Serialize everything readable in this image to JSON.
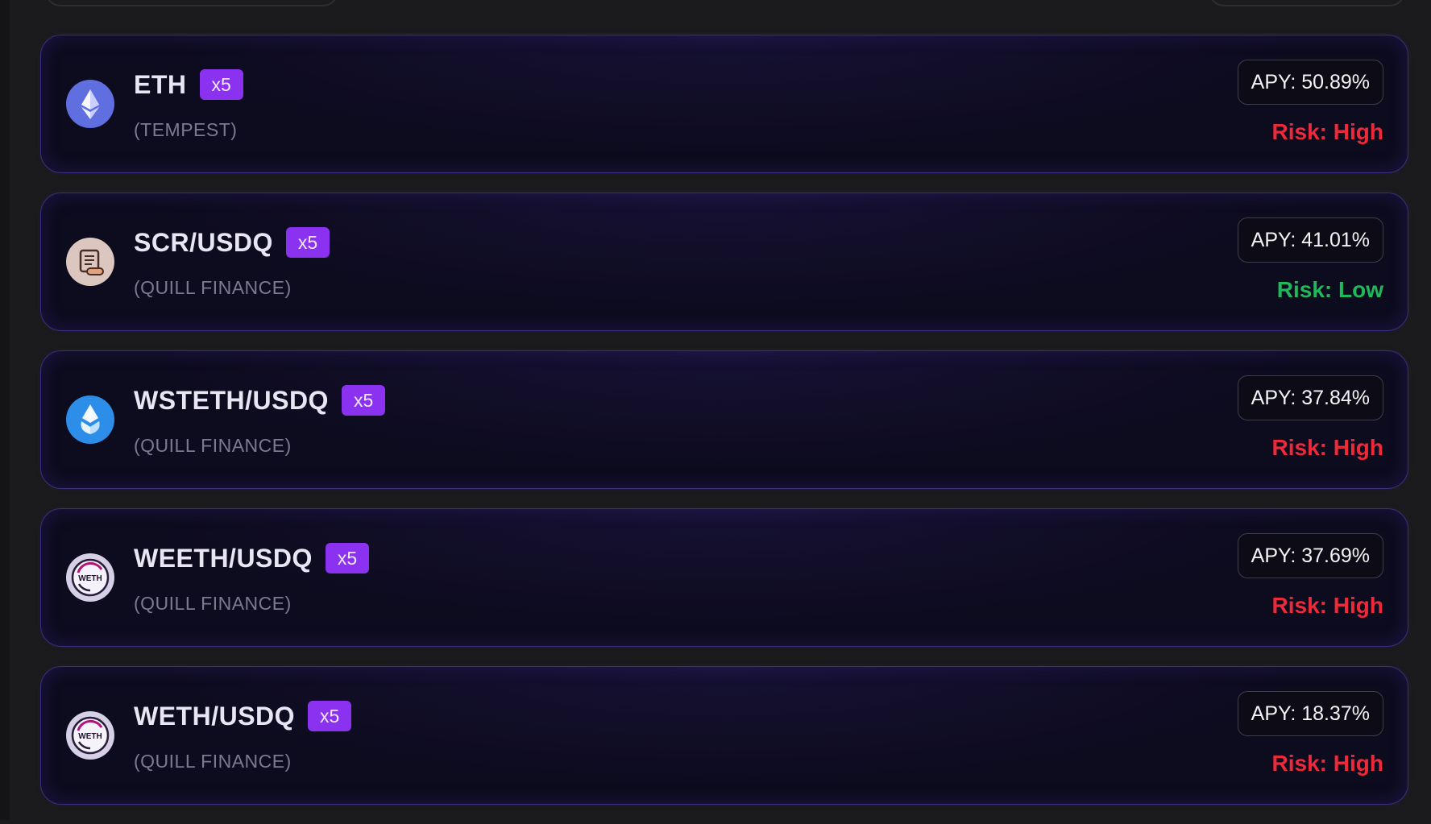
{
  "colors": {
    "risk_high": "#ee2a3a",
    "risk_low": "#1fb85a",
    "badge": "#8a32f0",
    "card_border": "#3b2f7e"
  },
  "pools": [
    {
      "name": "ETH",
      "leverage": "x5",
      "protocol": "(TEMPEST)",
      "apy": "APY: 50.89%",
      "risk": "Risk: High",
      "risk_level": "high",
      "icon": "ethereum-icon"
    },
    {
      "name": "SCR/USDQ",
      "leverage": "x5",
      "protocol": "(QUILL FINANCE)",
      "apy": "APY: 41.01%",
      "risk": "Risk: Low",
      "risk_level": "low",
      "icon": "scroll-icon"
    },
    {
      "name": "WSTETH/USDQ",
      "leverage": "x5",
      "protocol": "(QUILL FINANCE)",
      "apy": "APY: 37.84%",
      "risk": "Risk: High",
      "risk_level": "high",
      "icon": "wsteth-icon"
    },
    {
      "name": "WEETH/USDQ",
      "leverage": "x5",
      "protocol": "(QUILL FINANCE)",
      "apy": "APY: 37.69%",
      "risk": "Risk: High",
      "risk_level": "high",
      "icon": "weeth-icon",
      "icon_text": "WETH"
    },
    {
      "name": "WETH/USDQ",
      "leverage": "x5",
      "protocol": "(QUILL FINANCE)",
      "apy": "APY: 18.37%",
      "risk": "Risk: High",
      "risk_level": "high",
      "icon": "weth-icon",
      "icon_text": "WETH"
    }
  ]
}
